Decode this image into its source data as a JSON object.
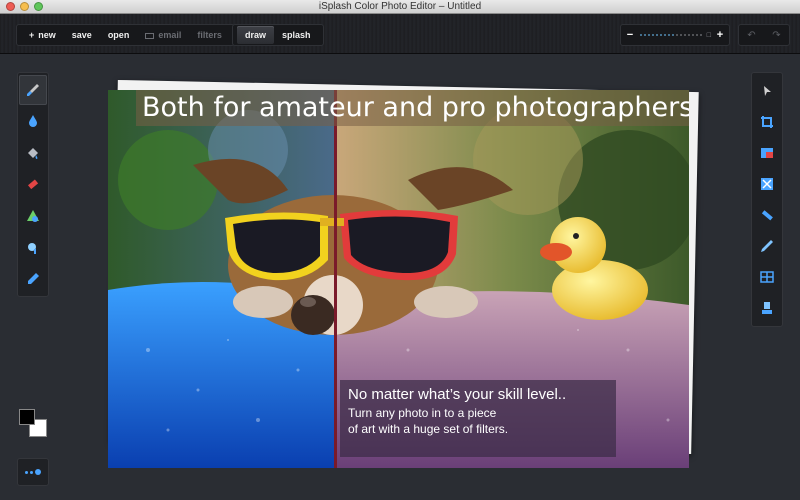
{
  "window": {
    "title": "iSplash Color Photo Editor  – Untitled"
  },
  "toolbar": {
    "file_group": [
      {
        "label": "new",
        "icon": "plus-icon",
        "enabled": true
      },
      {
        "label": "save",
        "enabled": true
      },
      {
        "label": "open",
        "enabled": true
      },
      {
        "label": "email",
        "icon": "envelope-icon",
        "enabled": false
      },
      {
        "label": "filters",
        "enabled": false
      }
    ],
    "mode_group": [
      {
        "label": "draw",
        "active": true
      },
      {
        "label": "splash",
        "active": false
      }
    ],
    "zoom": {
      "minus": "−",
      "plus": "+",
      "fit_icon": "fit-icon",
      "level": 0.55
    },
    "undo_icon": "undo-icon",
    "redo_icon": "redo-icon"
  },
  "left_tools": [
    {
      "name": "brush-icon",
      "active": true
    },
    {
      "name": "drop-icon",
      "active": false
    },
    {
      "name": "bucket-icon",
      "active": false
    },
    {
      "name": "eraser-icon",
      "active": false
    },
    {
      "name": "shape-icon",
      "active": false
    },
    {
      "name": "smudge-icon",
      "active": false
    },
    {
      "name": "picker-icon",
      "active": false
    }
  ],
  "right_tools": [
    {
      "name": "select-icon"
    },
    {
      "name": "crop-icon"
    },
    {
      "name": "color-adjust-icon"
    },
    {
      "name": "filter-icon"
    },
    {
      "name": "straighten-icon"
    },
    {
      "name": "pen-icon"
    },
    {
      "name": "window-icon"
    },
    {
      "name": "stamp-icon"
    }
  ],
  "colors": {
    "foreground": "#000000",
    "background": "#ffffff",
    "accent": "#4aa4ff"
  },
  "canvas": {
    "headline": "Both for amateur and pro photographers!",
    "info_title": "No matter what’s your skill level..",
    "info_line1": "Turn any photo in to a piece",
    "info_line2": "of art with a huge set of filters."
  }
}
